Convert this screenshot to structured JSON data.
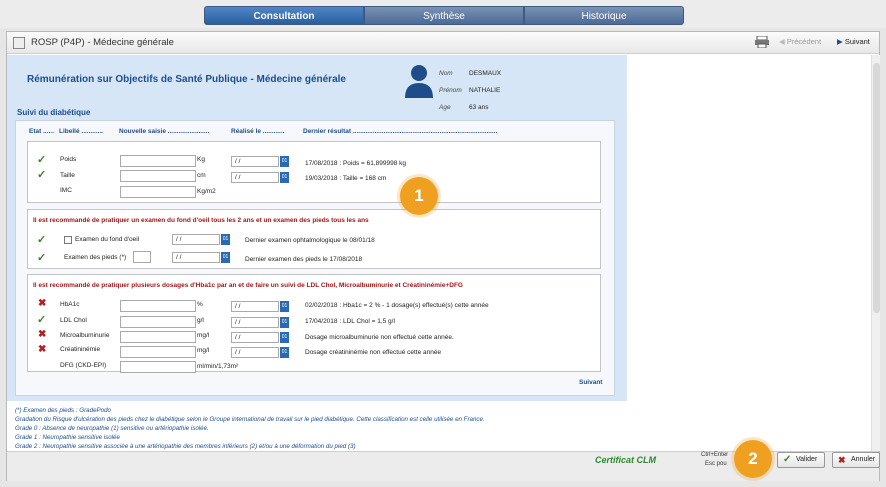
{
  "tabs": [
    {
      "label": "Consultation",
      "active": true
    },
    {
      "label": "Synthèse",
      "active": false
    },
    {
      "label": "Historique",
      "active": false
    }
  ],
  "window": {
    "title": "ROSP (P4P) - Médecine générale",
    "toolbar": {
      "precedent": "Précédent",
      "suivant": "Suivant"
    }
  },
  "main_title": "Rémunération sur Objectifs de Santé Publique - Médecine générale",
  "patient": {
    "nom_label": "Nom",
    "nom": "DESMAUX",
    "prenom_label": "Prénom",
    "prenom": "NATHALIE",
    "age_label": "Age",
    "age": "63 ans"
  },
  "section_title": "Suivi du diabétique",
  "columns": {
    "etat": "Etat ......",
    "libelle": "Libellé ............",
    "saisie": "Nouvelle saisie .......................",
    "realise": "Réalisé le ............",
    "dernier": "Dernier résultat ................................................................................"
  },
  "group1": [
    {
      "status": "check",
      "label": "Poids",
      "unit": "Kg",
      "date": " / /",
      "result": "17/08/2018  : Poids = 61,899998 kg"
    },
    {
      "status": "check",
      "label": "Taille",
      "unit": "cm",
      "date": " / /",
      "result": "19/03/2018  : Taille = 168 cm"
    },
    {
      "status": "none",
      "label": "IMC",
      "unit": "Kg/m2",
      "date": "",
      "result": ""
    }
  ],
  "group2": {
    "warning": "Il est recommandé de pratiquer un examen du fond d'oeil tous les 2 ans et un examen des pieds tous les ans",
    "fond_oeil_label": "Examen du fond d'oeil",
    "fond_oeil_date": " / /",
    "fond_oeil_result": "Dernier examen ophtalmologique le 08/01/18",
    "pieds_label": "Examen des pieds (*)",
    "pieds_date": " / /",
    "pieds_result": "Dernier examen des pieds le 17/08/2018"
  },
  "group3": {
    "warning": "Il est recommandé de pratiquer plusieurs dosages d'Hba1c par an et de faire un suivi de LDL Chol, Microalbuminurie et Créatininémie+DFG",
    "rows": [
      {
        "status": "cross",
        "label": "HbA1c",
        "unit": "%",
        "date": " / /",
        "result": "02/02/2018  : Hba1c = 2 % - 1 dosage(s) effectué(s) cette année"
      },
      {
        "status": "check",
        "label": "LDL Chol",
        "unit": "g/l",
        "date": " / /",
        "result": "17/04/2018  : LDL Chol = 1,5 g/l"
      },
      {
        "status": "cross",
        "label": "Microalbuminurie",
        "unit": "mg/l",
        "date": " / /",
        "result": "Dosage microalbuminurie non effectué cette année."
      },
      {
        "status": "cross",
        "label": "Créatininémie",
        "unit": "mg/l",
        "date": " / /",
        "result": "Dosage créatininémie non effectué cette année"
      },
      {
        "status": "none",
        "label": "DFG (CKD-EPI)",
        "unit": "ml/min/1,73m²",
        "date": "",
        "result": ""
      }
    ]
  },
  "suivant_link": "Suivant",
  "notes": [
    "(*) Examen des pieds : GradePodo",
    "Gradation du Risque d'ulcération des pieds chez le diabétique selon le Groupe international de travail sur le pied diabétique. Cette classification est celle utilisée en France.",
    "Grade 0 : Absence de neuropathie (1) sensitive ou artériopathie isolée.",
    "Grade 1 : Neuropathie sensitive isolée",
    "Grade 2 : Neuropathie sensitive associée à une artériopathie des membres inférieurs (2) et/ou à une déformation du pied (3)"
  ],
  "footer": {
    "cert": "Certificat CLM",
    "kbd1": "Ctrl+Enter",
    "kbd2": "Esc pou",
    "valider": "Valider",
    "annuler": "Annuler"
  },
  "badges": [
    "1",
    "2"
  ],
  "colors": {
    "accent": "#1f4d8a",
    "warning": "#a01818",
    "badge": "#f0a020",
    "check": "#3f7f2f",
    "cross": "#b02020"
  }
}
